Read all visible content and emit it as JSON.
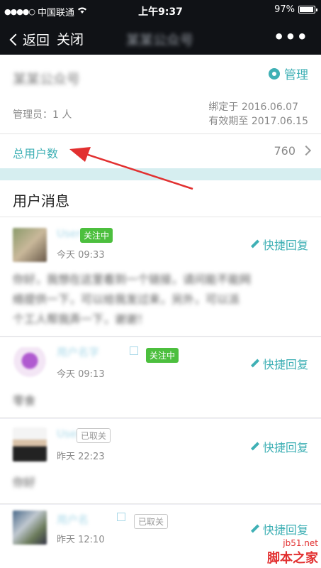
{
  "status_bar": {
    "carrier": "中国联通",
    "time": "上午9:37",
    "battery": "97%"
  },
  "nav": {
    "back_label": "返回",
    "close_label": "关闭",
    "title": "某某公众号",
    "more": "•••"
  },
  "account": {
    "name": "某某公众号",
    "manage_label": "管理",
    "admin_label": "管理员：1 人",
    "bind_date": "绑定于 2016.06.07",
    "valid_until": "有效期至 2017.06.15",
    "total_users_label": "总用户数",
    "total_users_value": "760"
  },
  "section_title": "用户消息",
  "messages": [
    {
      "username": "User",
      "status": "关注中",
      "time": "今天 09:33",
      "reply_label": "快捷回复",
      "text_lines": [
        "你好，我想在这里看到一个链接，请问能不能网",
        "络提供一下，可以给我发过来，另外，可以派",
        "个工人帮我弄一下，谢谢！"
      ]
    },
    {
      "username": "用户名字",
      "status": "关注中",
      "time": "今天 09:13",
      "reply_label": "快捷回复",
      "text": "零食"
    },
    {
      "username": "User",
      "status": "已取关",
      "time": "昨天 22:23",
      "reply_label": "快捷回复",
      "text": "你好"
    },
    {
      "username": "用户名",
      "status": "已取关",
      "time": "昨天 12:10",
      "reply_label": "快捷回复"
    }
  ],
  "watermark": {
    "site": "jb51.net",
    "name": "脚本之家"
  },
  "colors": {
    "accent": "#3fb0b5",
    "follow_badge": "#4cbf3e",
    "navbar": "#101216"
  }
}
